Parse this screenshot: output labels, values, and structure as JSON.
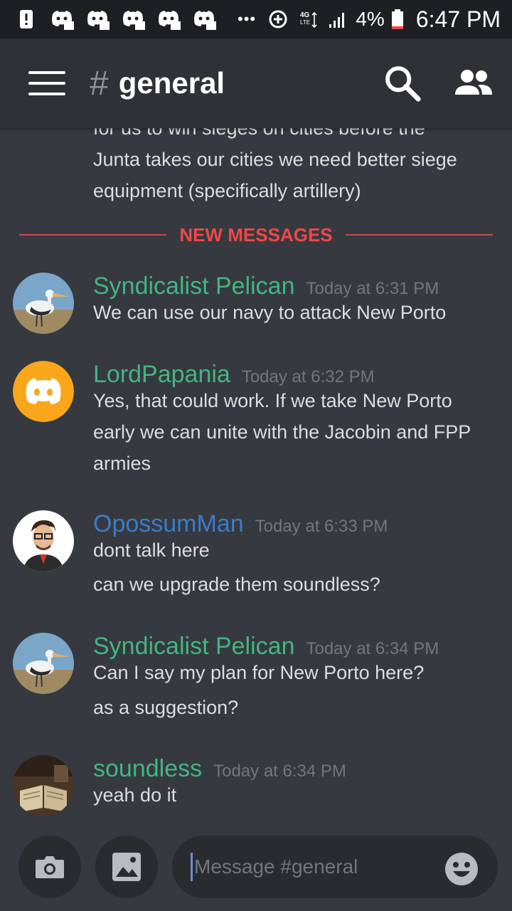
{
  "status_bar": {
    "battery": "4%",
    "time": "6:47 PM",
    "network": "4G LTE",
    "icons": [
      "alert-icon",
      "discord-notification-icon",
      "discord-notification-icon",
      "discord-notification-icon",
      "discord-notification-icon",
      "discord-notification-icon",
      "more-icon",
      "data-saver-icon",
      "network-4g-icon",
      "signal-icon",
      "battery-icon"
    ]
  },
  "header": {
    "hash": "#",
    "channel": "general",
    "icons": [
      "menu-icon",
      "search-icon",
      "members-icon"
    ]
  },
  "continued_message": {
    "lines": [
      "for us to win sieges on cities before the",
      "Junta takes our cities we need better siege",
      "equipment (specifically artillery)"
    ]
  },
  "divider": {
    "label": "NEW MESSAGES",
    "color": "#f04747"
  },
  "messages": [
    {
      "author": "Syndicalist Pelican",
      "author_color": "#43b581",
      "timestamp": "Today at 6:31 PM",
      "avatar": "pelican-avatar",
      "lines": [
        "We can use our navy to attack New Porto"
      ]
    },
    {
      "author": "LordPapania",
      "author_color": "#43b581",
      "timestamp": "Today at 6:32 PM",
      "avatar": "discord-default-avatar",
      "lines": [
        "Yes, that could work. If we take New Porto",
        "early we can unite with the Jacobin and FPP",
        "armies"
      ]
    },
    {
      "author": "OpossumMan",
      "author_color": "#3b7cc9",
      "timestamp": "Today at 6:33 PM",
      "avatar": "cartoon-man-avatar",
      "lines": [
        "dont talk here",
        "can we upgrade them soundless?"
      ]
    },
    {
      "author": "Syndicalist Pelican",
      "author_color": "#43b581",
      "timestamp": "Today at 6:34 PM",
      "avatar": "pelican-avatar",
      "lines": [
        "Can I say my plan for New Porto here?",
        "as a suggestion?"
      ]
    },
    {
      "author": "soundless",
      "author_color": "#43b581",
      "timestamp": "Today at 6:34 PM",
      "avatar": "book-avatar",
      "lines": [
        "yeah do it"
      ]
    }
  ],
  "composer": {
    "placeholder": "Message #general",
    "icons": [
      "camera-icon",
      "image-icon",
      "emoji-icon"
    ]
  },
  "colors": {
    "background": "#36393f",
    "header": "#2f3136",
    "status_bar": "#1e1f22",
    "text": "#dcddde",
    "muted": "#72767d"
  }
}
